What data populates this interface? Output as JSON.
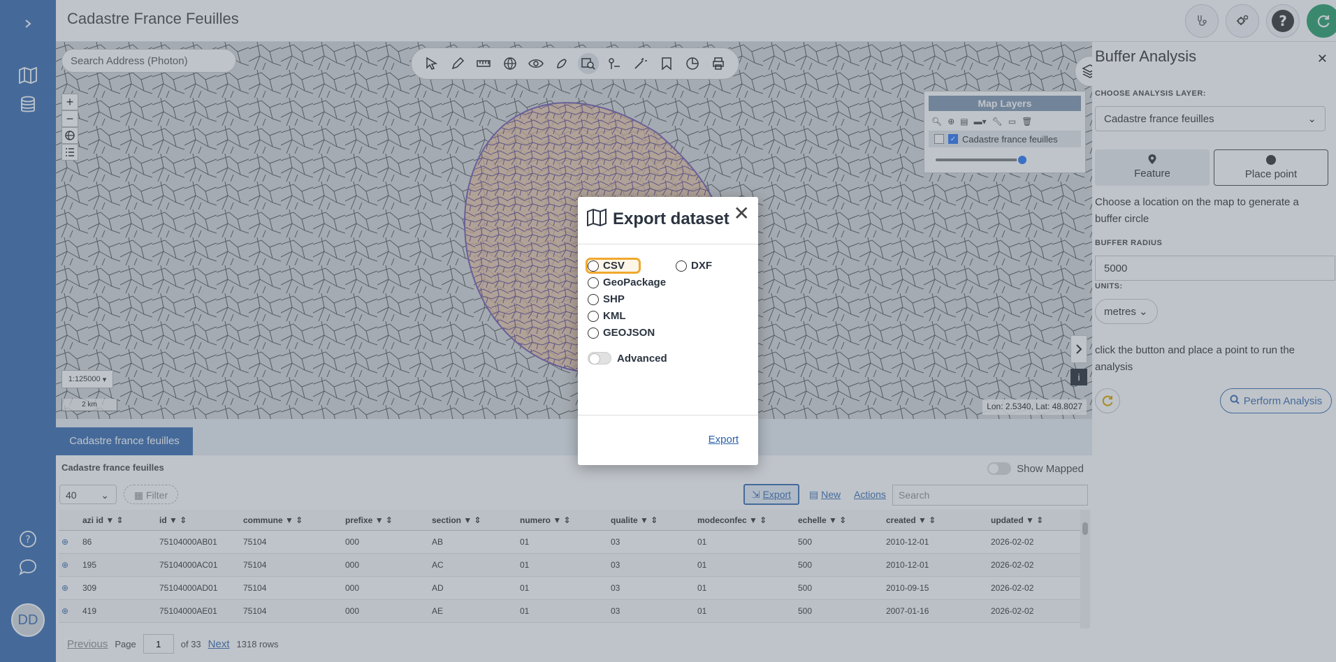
{
  "app": {
    "title": "Cadastre France Feuilles",
    "user_initials": "DD"
  },
  "sidebar": {
    "items": [
      {
        "icon": "chevron-right-icon"
      },
      {
        "icon": "map-icon"
      },
      {
        "icon": "database-icon"
      },
      {
        "icon": "help-icon"
      },
      {
        "icon": "chat-icon"
      }
    ]
  },
  "map": {
    "search_placeholder": "Search Address (Photon)",
    "scale": "1:125000",
    "scale_bar": "2 km",
    "coords": "Lon: 2.5340, Lat: 48.8027",
    "zoom_in": "+",
    "zoom_out": "−"
  },
  "layers_panel": {
    "title": "Map Layers",
    "layer_name": "Cadastre france feuilles",
    "opacity_fraction": 0.95
  },
  "buffer_panel": {
    "title": "Buffer Analysis",
    "choose_layer_label": "CHOOSE ANALYSIS LAYER:",
    "layer_value": "Cadastre france feuilles",
    "tab_feature": "Feature",
    "tab_place": "Place point",
    "choose_location_text": "Choose a location on the map to generate a buffer circle",
    "radius_label": "BUFFER RADIUS",
    "radius_value": "5000",
    "units_label": "UNITS:",
    "units_value": "metres",
    "run_text": "click the button and place a point to run the analysis",
    "perform_label": "Perform Analysis"
  },
  "table": {
    "tab_label": "Cadastre france feuilles",
    "title": "Cadastre france feuilles",
    "show_mapped_label": "Show Mapped",
    "page_size": "40",
    "filter_label": "Filter",
    "export_label": "Export",
    "new_label": "New",
    "actions_label": "Actions",
    "search_placeholder": "Search",
    "columns": [
      "azi id",
      "id",
      "commune",
      "prefixe",
      "section",
      "numero",
      "qualite",
      "modeconfec",
      "echelle",
      "created",
      "updated"
    ],
    "rows": [
      [
        "86",
        "75104000AB01",
        "75104",
        "000",
        "AB",
        "01",
        "03",
        "01",
        "500",
        "2010-12-01",
        "2026-02-02"
      ],
      [
        "195",
        "75104000AC01",
        "75104",
        "000",
        "AC",
        "01",
        "03",
        "01",
        "500",
        "2010-12-01",
        "2026-02-02"
      ],
      [
        "309",
        "75104000AD01",
        "75104",
        "000",
        "AD",
        "01",
        "03",
        "01",
        "500",
        "2010-09-15",
        "2026-02-02"
      ],
      [
        "419",
        "75104000AE01",
        "75104",
        "000",
        "AE",
        "01",
        "03",
        "01",
        "500",
        "2007-01-16",
        "2026-02-02"
      ]
    ],
    "pager": {
      "previous": "Previous",
      "page_label": "Page",
      "page_value": "1",
      "of_label": "of 33",
      "next": "Next",
      "rows_label": "1318 rows"
    }
  },
  "modal": {
    "title": "Export dataset",
    "options": [
      "CSV",
      "DXF",
      "GeoPackage",
      "SHP",
      "KML",
      "GEOJSON"
    ],
    "advanced_label": "Advanced",
    "export_link": "Export"
  }
}
